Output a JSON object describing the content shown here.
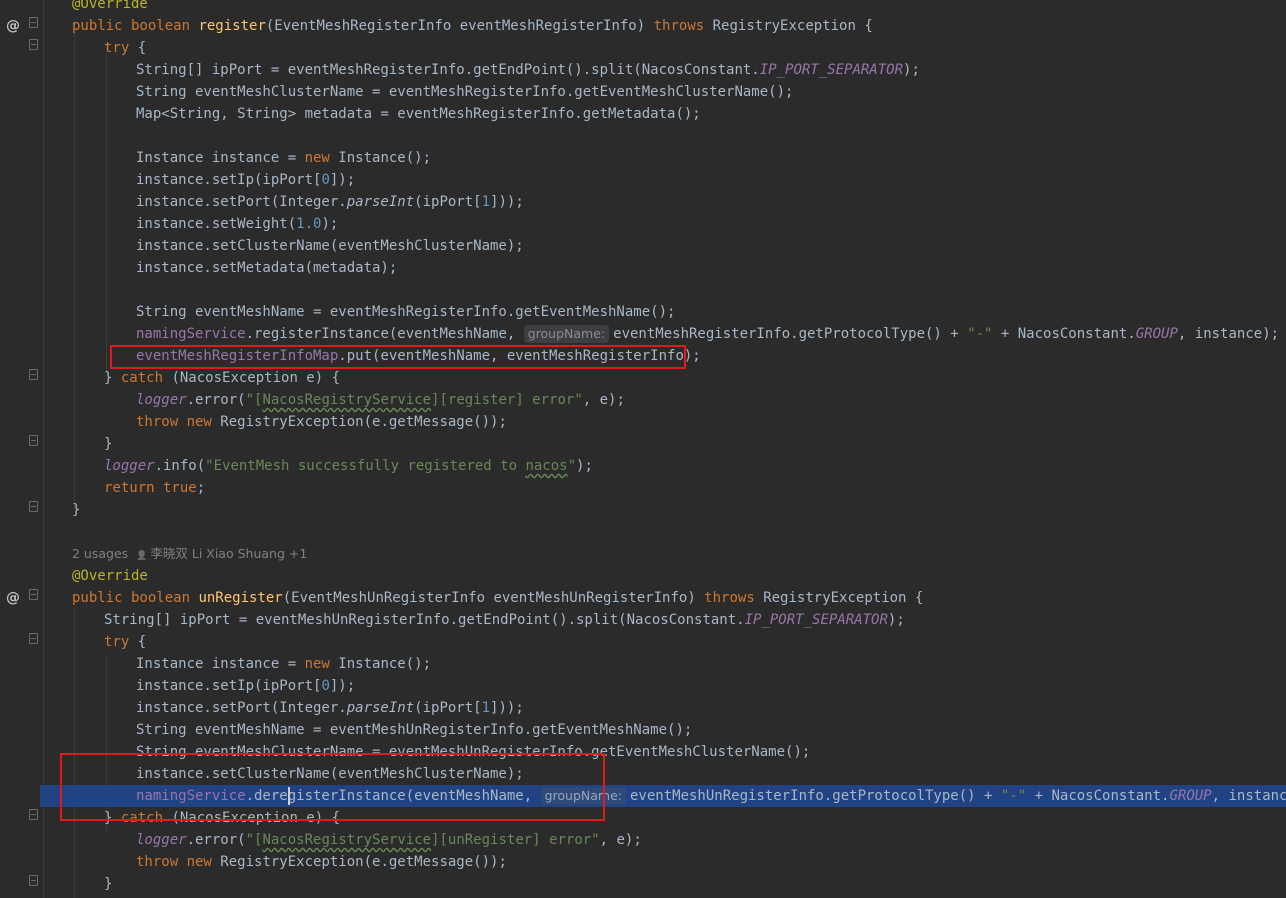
{
  "editor": {
    "inlay": {
      "usages": "2 usages",
      "author_icon": "person-icon",
      "authors": "李晓双 Li Xiao Shuang +1"
    },
    "hint_label": "groupName:",
    "gutter_marker": "@",
    "lines": [
      {
        "indent": 0,
        "tokens": [
          [
            "ann",
            "@Override"
          ]
        ]
      },
      {
        "indent": 0,
        "marker": true,
        "tokens": [
          [
            "kw",
            "public boolean "
          ],
          [
            "fn",
            "register"
          ],
          [
            "plain",
            "(EventMeshRegisterInfo eventMeshRegisterInfo) "
          ],
          [
            "kw",
            "throws "
          ],
          [
            "plain",
            "RegistryException {"
          ]
        ]
      },
      {
        "indent": 1,
        "tokens": [
          [
            "kw",
            "try "
          ],
          [
            "plain",
            "{"
          ]
        ]
      },
      {
        "indent": 2,
        "tokens": [
          [
            "plain",
            "String[] ipPort = eventMeshRegisterInfo.getEndPoint().split(NacosConstant."
          ],
          [
            "ifield",
            "IP_PORT_SEPARATOR"
          ],
          [
            "plain",
            ");"
          ]
        ]
      },
      {
        "indent": 2,
        "tokens": [
          [
            "plain",
            "String eventMeshClusterName = eventMeshRegisterInfo.getEventMeshClusterName();"
          ]
        ]
      },
      {
        "indent": 2,
        "tokens": [
          [
            "plain",
            "Map<String, String> metadata = eventMeshRegisterInfo.getMetadata();"
          ]
        ]
      },
      {
        "indent": 0,
        "tokens": []
      },
      {
        "indent": 2,
        "tokens": [
          [
            "plain",
            "Instance instance = "
          ],
          [
            "kw",
            "new "
          ],
          [
            "plain",
            "Instance();"
          ]
        ]
      },
      {
        "indent": 2,
        "tokens": [
          [
            "plain",
            "instance.setIp(ipPort["
          ],
          [
            "num",
            "0"
          ],
          [
            "plain",
            "]);"
          ]
        ]
      },
      {
        "indent": 2,
        "tokens": [
          [
            "plain",
            "instance.setPort(Integer."
          ],
          [
            "italic",
            "parseInt"
          ],
          [
            "plain",
            "(ipPort["
          ],
          [
            "num",
            "1"
          ],
          [
            "plain",
            "]));"
          ]
        ]
      },
      {
        "indent": 2,
        "tokens": [
          [
            "plain",
            "instance.setWeight("
          ],
          [
            "num",
            "1.0"
          ],
          [
            "plain",
            ");"
          ]
        ]
      },
      {
        "indent": 2,
        "tokens": [
          [
            "plain",
            "instance.setClusterName(eventMeshClusterName);"
          ]
        ]
      },
      {
        "indent": 2,
        "tokens": [
          [
            "plain",
            "instance.setMetadata(metadata);"
          ]
        ]
      },
      {
        "indent": 0,
        "tokens": []
      },
      {
        "indent": 2,
        "tokens": [
          [
            "plain",
            "String eventMeshName = eventMeshRegisterInfo.getEventMeshName();"
          ]
        ]
      },
      {
        "indent": 2,
        "tokens": [
          [
            "field",
            "namingService"
          ],
          [
            "plain",
            ".registerInstance(eventMeshName, "
          ],
          [
            "hint",
            "groupName:"
          ],
          [
            "plain",
            "eventMeshRegisterInfo.getProtocolType() + "
          ],
          [
            "str",
            "\"-\""
          ],
          [
            "plain",
            " + NacosConstant."
          ],
          [
            "ifield",
            "GROUP"
          ],
          [
            "plain",
            ", instance);"
          ]
        ]
      },
      {
        "indent": 2,
        "tokens": [
          [
            "field",
            "eventMeshRegisterInfoMap"
          ],
          [
            "plain",
            ".put(eventMeshName, eventMeshRegisterInfo);"
          ]
        ]
      },
      {
        "indent": 1,
        "tokens": [
          [
            "plain",
            "} "
          ],
          [
            "kw",
            "catch "
          ],
          [
            "plain",
            "(NacosException e) {"
          ]
        ]
      },
      {
        "indent": 2,
        "tokens": [
          [
            "ifield",
            "logger"
          ],
          [
            "plain",
            ".error("
          ],
          [
            "str",
            "\"["
          ],
          [
            "str_sq",
            "NacosRegistryService"
          ],
          [
            "str",
            "][register] error\""
          ],
          [
            "plain",
            ", e);"
          ]
        ]
      },
      {
        "indent": 2,
        "tokens": [
          [
            "kw",
            "throw new "
          ],
          [
            "plain",
            "RegistryException(e.getMessage());"
          ]
        ]
      },
      {
        "indent": 1,
        "tokens": [
          [
            "plain",
            "}"
          ]
        ]
      },
      {
        "indent": 1,
        "tokens": [
          [
            "ifield",
            "logger"
          ],
          [
            "plain",
            ".info("
          ],
          [
            "str",
            "\"EventMesh successfully registered to "
          ],
          [
            "str_sq",
            "nacos"
          ],
          [
            "str",
            "\""
          ],
          [
            "plain",
            ");"
          ]
        ]
      },
      {
        "indent": 1,
        "tokens": [
          [
            "kw",
            "return true"
          ],
          [
            "plain",
            ";"
          ]
        ]
      },
      {
        "indent": 0,
        "tokens": [
          [
            "plain",
            "}"
          ]
        ]
      },
      {
        "indent": 0,
        "tokens": []
      },
      {
        "indent": 0,
        "inlay": true,
        "tokens": []
      },
      {
        "indent": 0,
        "tokens": [
          [
            "ann",
            "@Override"
          ]
        ]
      },
      {
        "indent": 0,
        "marker": true,
        "tokens": [
          [
            "kw",
            "public boolean "
          ],
          [
            "fn",
            "unRegister"
          ],
          [
            "plain",
            "(EventMeshUnRegisterInfo eventMeshUnRegisterInfo) "
          ],
          [
            "kw",
            "throws "
          ],
          [
            "plain",
            "RegistryException {"
          ]
        ]
      },
      {
        "indent": 1,
        "tokens": [
          [
            "plain",
            "String[] ipPort = eventMeshUnRegisterInfo.getEndPoint().split(NacosConstant."
          ],
          [
            "ifield",
            "IP_PORT_SEPARATOR"
          ],
          [
            "plain",
            ");"
          ]
        ]
      },
      {
        "indent": 1,
        "tokens": [
          [
            "kw",
            "try "
          ],
          [
            "plain",
            "{"
          ]
        ]
      },
      {
        "indent": 2,
        "tokens": [
          [
            "plain",
            "Instance instance = "
          ],
          [
            "kw",
            "new "
          ],
          [
            "plain",
            "Instance();"
          ]
        ]
      },
      {
        "indent": 2,
        "tokens": [
          [
            "plain",
            "instance.setIp(ipPort["
          ],
          [
            "num",
            "0"
          ],
          [
            "plain",
            "]);"
          ]
        ]
      },
      {
        "indent": 2,
        "tokens": [
          [
            "plain",
            "instance.setPort(Integer."
          ],
          [
            "italic",
            "parseInt"
          ],
          [
            "plain",
            "(ipPort["
          ],
          [
            "num",
            "1"
          ],
          [
            "plain",
            "]));"
          ]
        ]
      },
      {
        "indent": 2,
        "tokens": [
          [
            "plain",
            "String eventMeshName = eventMeshUnRegisterInfo.getEventMeshName();"
          ]
        ]
      },
      {
        "indent": 2,
        "tokens": [
          [
            "plain",
            "String eventMeshClusterName = eventMeshUnRegisterInfo.getEventMeshClusterName();"
          ]
        ]
      },
      {
        "indent": 2,
        "tokens": [
          [
            "plain",
            "instance.setClusterName(eventMeshClusterName);"
          ]
        ]
      },
      {
        "indent": 2,
        "caret": true,
        "tokens": [
          [
            "field",
            "namingService"
          ],
          [
            "plain",
            ".deregisterInstance(eventMeshName, "
          ],
          [
            "hint",
            "groupName:"
          ],
          [
            "plain",
            "eventMeshUnRegisterInfo.getProtocolType() + "
          ],
          [
            "str",
            "\"-\""
          ],
          [
            "plain",
            " + NacosConstant."
          ],
          [
            "ifield",
            "GROUP"
          ],
          [
            "plain",
            ", instance);"
          ]
        ]
      },
      {
        "indent": 1,
        "tokens": [
          [
            "plain",
            "} "
          ],
          [
            "kw",
            "catch "
          ],
          [
            "plain",
            "(NacosException e) {"
          ]
        ]
      },
      {
        "indent": 2,
        "tokens": [
          [
            "ifield",
            "logger"
          ],
          [
            "plain",
            ".error("
          ],
          [
            "str",
            "\"["
          ],
          [
            "str_sq",
            "NacosRegistryService"
          ],
          [
            "str",
            "][unRegister] error\""
          ],
          [
            "plain",
            ", e);"
          ]
        ]
      },
      {
        "indent": 2,
        "tokens": [
          [
            "kw",
            "throw new "
          ],
          [
            "plain",
            "RegistryException(e.getMessage());"
          ]
        ]
      },
      {
        "indent": 1,
        "tokens": [
          [
            "plain",
            "}"
          ]
        ]
      }
    ]
  }
}
